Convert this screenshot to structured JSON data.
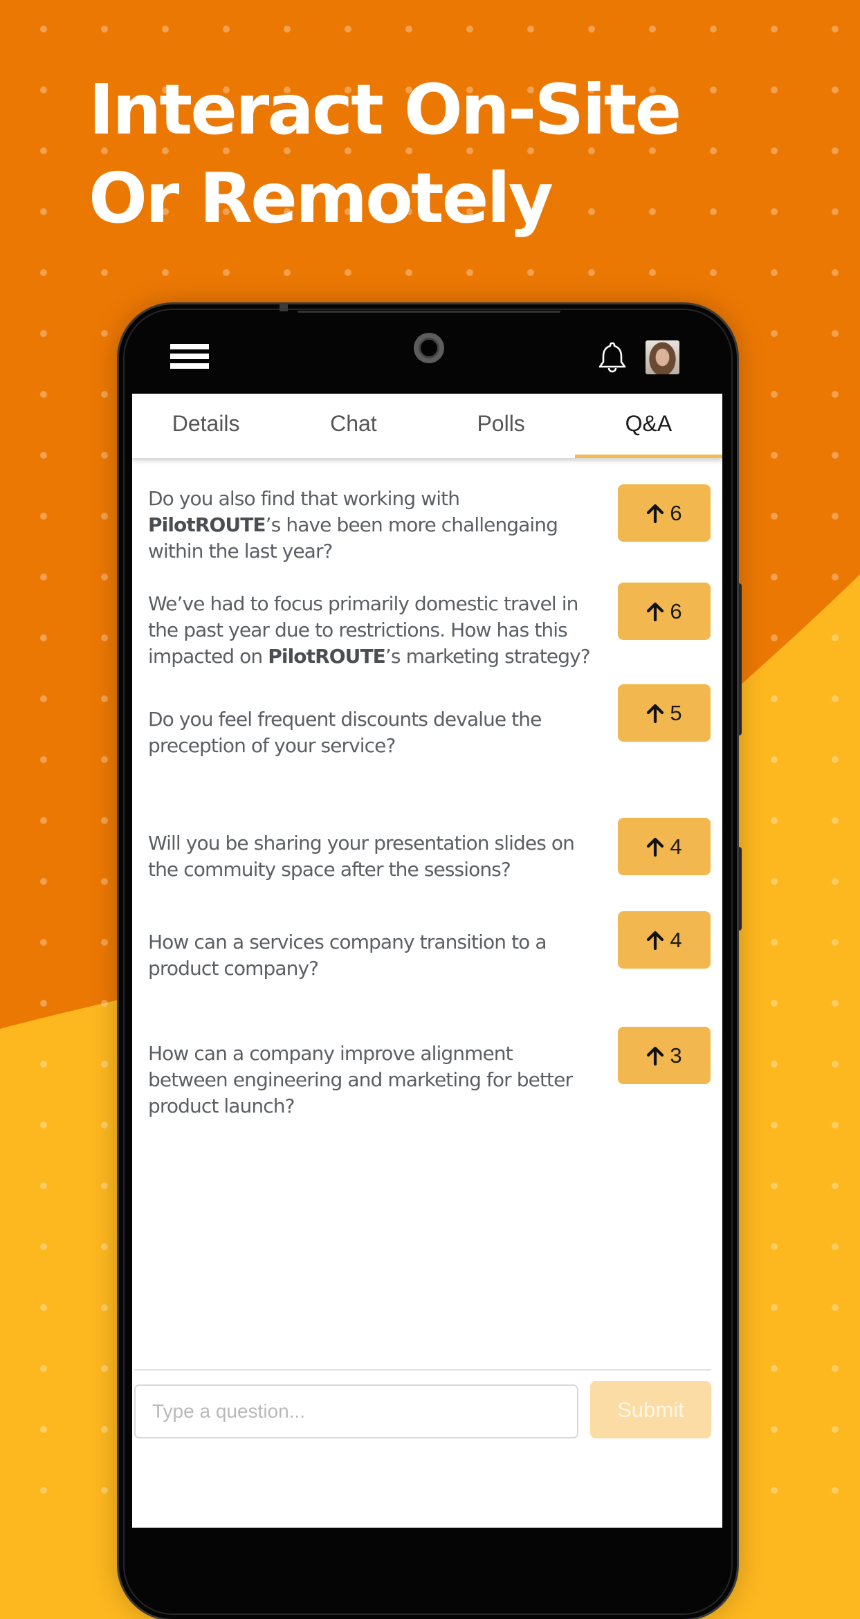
{
  "colors": {
    "orange": "#EC7804",
    "yellow": "#FDB71F",
    "accent": "#F2B84F",
    "submit_disabled": "#FBDCA4"
  },
  "headline": {
    "line1": "Interact On-Site",
    "line2": "Or Remotely"
  },
  "app_header": {
    "menu_icon": "hamburger-menu-icon",
    "notification_icon": "bell-icon",
    "avatar": "user-avatar-photo"
  },
  "tabs": [
    {
      "label": "Details",
      "active": false
    },
    {
      "label": "Chat",
      "active": false
    },
    {
      "label": "Polls",
      "active": false
    },
    {
      "label": "Q&A",
      "active": true
    }
  ],
  "questions": [
    {
      "parts": [
        {
          "t": "Do you also find that working with "
        },
        {
          "t": "PilotROUTE",
          "b": true
        },
        {
          "t": "’s have been more challengaing within the last year?"
        }
      ],
      "votes": "6"
    },
    {
      "parts": [
        {
          "t": "We’ve had to focus primarily domestic travel in the past year due to restrictions. How has this impacted on "
        },
        {
          "t": "PilotROUTE",
          "b": true
        },
        {
          "t": "’s marketing strategy?"
        }
      ],
      "votes": "6"
    },
    {
      "parts": [
        {
          "t": "Do you feel frequent discounts devalue the preception of your service?"
        }
      ],
      "votes": "5"
    },
    {
      "parts": [
        {
          "t": "Will you be sharing your presentation slides on the commuity space after the sessions?"
        }
      ],
      "votes": "4"
    },
    {
      "parts": [
        {
          "t": "How can a services company transition to a product company?"
        }
      ],
      "votes": "4"
    },
    {
      "parts": [
        {
          "t": "How can a company improve alignment between engineering and marketing for better product launch?"
        }
      ],
      "votes": "3"
    }
  ],
  "upvote_icon": "arrow-up-icon",
  "composer": {
    "placeholder": "Type a question...",
    "value": "",
    "submit_label": "Submit"
  }
}
